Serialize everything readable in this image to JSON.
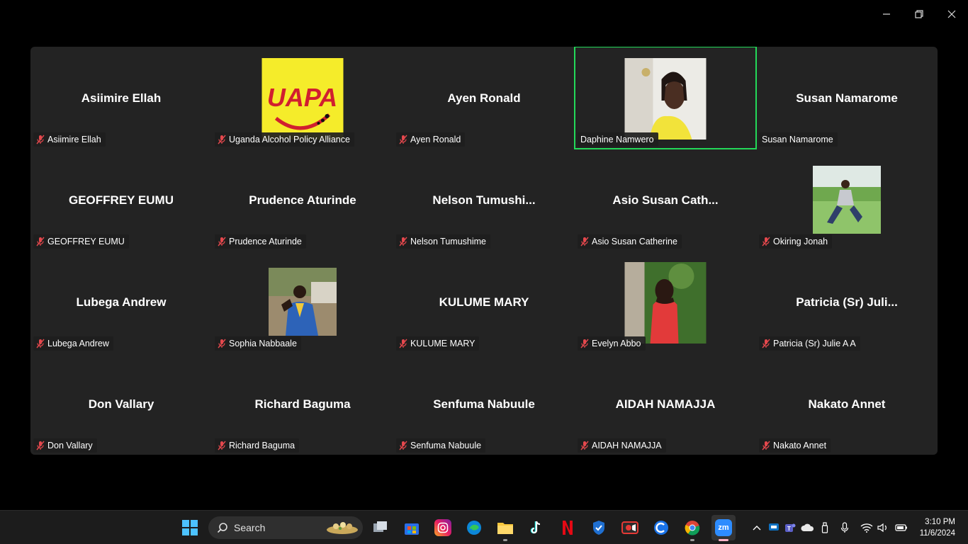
{
  "window": {
    "controls": [
      "minimize",
      "restore",
      "close"
    ]
  },
  "participants": [
    {
      "display": "Asiimire Ellah",
      "label": "Asiimire Ellah",
      "muted": true,
      "photo": false
    },
    {
      "display": "",
      "label": "Uganda Alcohol Policy Alliance",
      "muted": true,
      "photo": "uapa-logo"
    },
    {
      "display": "Ayen Ronald",
      "label": "Ayen Ronald",
      "muted": true,
      "photo": false
    },
    {
      "display": "",
      "label": "Daphine Namwero",
      "muted": false,
      "photo": "person-yellow",
      "active": true
    },
    {
      "display": "Susan Namarome",
      "label": "Susan Namarome",
      "muted": false,
      "photo": false
    },
    {
      "display": "GEOFFREY EUMU",
      "label": "GEOFFREY EUMU",
      "muted": true,
      "photo": false
    },
    {
      "display": "Prudence Aturinde",
      "label": "Prudence Aturinde",
      "muted": true,
      "photo": false
    },
    {
      "display": "Nelson  Tumushi...",
      "label": "Nelson Tumushime",
      "muted": true,
      "photo": false
    },
    {
      "display": "Asio Susan Cath...",
      "label": "Asio Susan Catherine",
      "muted": true,
      "photo": false
    },
    {
      "display": "",
      "label": "Okiring Jonah",
      "muted": true,
      "photo": "person-grass"
    },
    {
      "display": "Lubega Andrew",
      "label": "Lubega Andrew",
      "muted": true,
      "photo": false
    },
    {
      "display": "",
      "label": "Sophia Nabbaale",
      "muted": true,
      "photo": "person-blue"
    },
    {
      "display": "KULUME MARY",
      "label": "KULUME MARY",
      "muted": true,
      "photo": false
    },
    {
      "display": "",
      "label": "Evelyn Abbo",
      "muted": true,
      "photo": "person-red"
    },
    {
      "display": "Patricia  (Sr) Juli...",
      "label": "Patricia  (Sr) Julie A A",
      "muted": true,
      "photo": false
    },
    {
      "display": "Don Vallary",
      "label": "Don Vallary",
      "muted": true,
      "photo": false
    },
    {
      "display": "Richard Baguma",
      "label": "Richard Baguma",
      "muted": true,
      "photo": false
    },
    {
      "display": "Senfuma Nabuule",
      "label": "Senfuma Nabuule",
      "muted": true,
      "photo": false
    },
    {
      "display": "AIDAH NAMAJJA",
      "label": "AIDAH NAMAJJA",
      "muted": true,
      "photo": false
    },
    {
      "display": "Nakato Annet",
      "label": "Nakato Annet",
      "muted": true,
      "photo": false
    }
  ],
  "taskbar": {
    "search_label": "Search",
    "apps": [
      "windows-start",
      "task-view",
      "microsoft-store",
      "instagram",
      "edge",
      "file-explorer",
      "tiktok",
      "netflix",
      "security-shield",
      "screen-recorder",
      "ccleaner",
      "chrome",
      "zoom"
    ],
    "clock_time": "3:10 PM",
    "clock_date": "11/6/2024"
  },
  "colors": {
    "gallery_bg": "#232323",
    "active_border": "#23d959",
    "muted_red": "#e5484d",
    "zoom_blue": "#2d8cff"
  }
}
